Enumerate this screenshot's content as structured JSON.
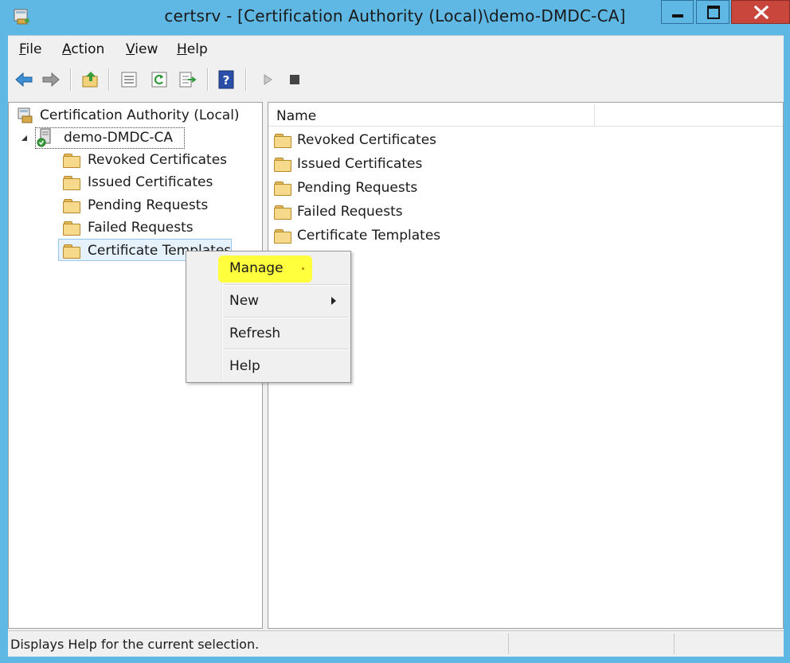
{
  "window": {
    "title": "certsrv - [Certification Authority (Local)\\demo-DMDC-CA]",
    "icon": "certsrv-app-icon",
    "controls": [
      "minimize",
      "maximize",
      "close"
    ]
  },
  "menubar": {
    "items": [
      {
        "label": "File",
        "access_key": "F"
      },
      {
        "label": "Action",
        "access_key": "A"
      },
      {
        "label": "View",
        "access_key": "V"
      },
      {
        "label": "Help",
        "access_key": "H"
      }
    ]
  },
  "toolbar": {
    "buttons": [
      "back-icon",
      "forward-icon",
      "up-folder-icon",
      "properties-icon",
      "refresh-icon",
      "export-list-icon",
      "help-icon",
      "start-service-icon",
      "stop-service-icon"
    ]
  },
  "tree": {
    "root": "Certification Authority (Local)",
    "ca": "demo-DMDC-CA",
    "children": [
      "Revoked Certificates",
      "Issued Certificates",
      "Pending Requests",
      "Failed Requests",
      "Certificate Templates"
    ],
    "selected": "Certificate Templates"
  },
  "list": {
    "column_name": "Name",
    "items": [
      "Revoked Certificates",
      "Issued Certificates",
      "Pending Requests",
      "Failed Requests",
      "Certificate Templates"
    ]
  },
  "context_menu": {
    "items": [
      {
        "label": "Manage",
        "highlighted": true
      },
      {
        "label": "New",
        "has_submenu": true
      },
      {
        "label": "Refresh"
      },
      {
        "label": "Help"
      }
    ],
    "highlight_color": "#ffff33"
  },
  "statusbar": {
    "text": "Displays Help for the current selection."
  },
  "colors": {
    "frame": "#5fb7e3",
    "close_button": "#c9463d",
    "chrome": "#f0f0f0",
    "selection": "#e5f1fb"
  }
}
